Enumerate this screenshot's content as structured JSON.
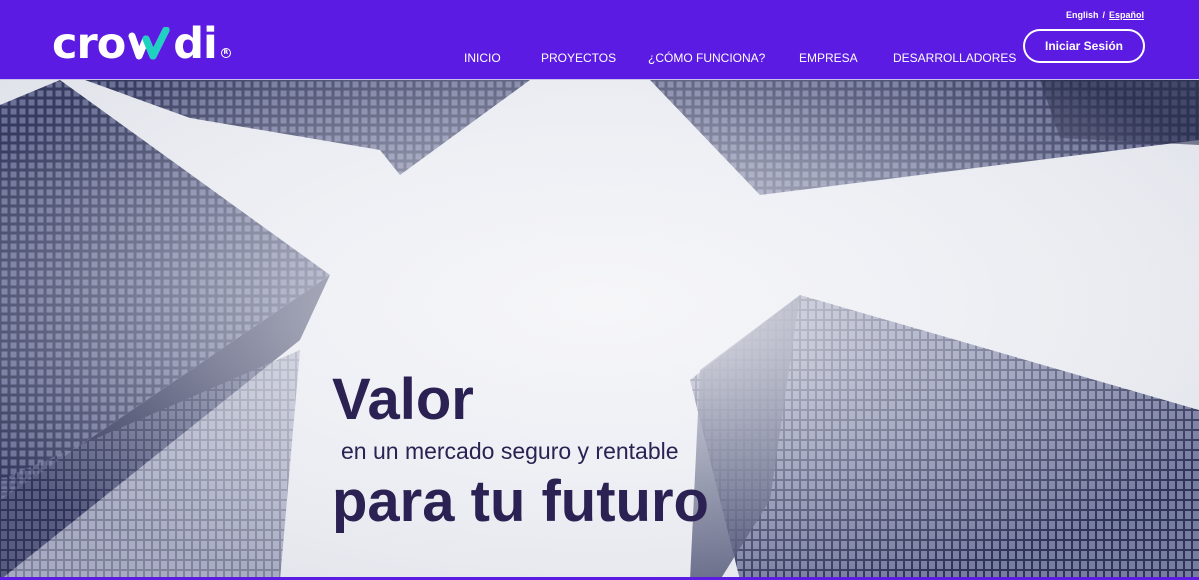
{
  "brand": {
    "logo_left": "cro",
    "logo_right": "di",
    "logo_reg": "R",
    "primary_color": "#5b1be3",
    "accent_color": "#1fd1c1",
    "headline_color": "#2b2152"
  },
  "language": {
    "english": "English",
    "separator": "/",
    "spanish": "Español"
  },
  "nav": {
    "items": [
      "INICIO",
      "PROYECTOS",
      "¿CÓMO FUNCIONA?",
      "EMPRESA",
      "DESARROLLADORES"
    ]
  },
  "login": {
    "label": "Iniciar Sesión"
  },
  "hero": {
    "line1": "Valor",
    "line2": "en un mercado seguro y rentable",
    "line3": "para tu futuro"
  }
}
